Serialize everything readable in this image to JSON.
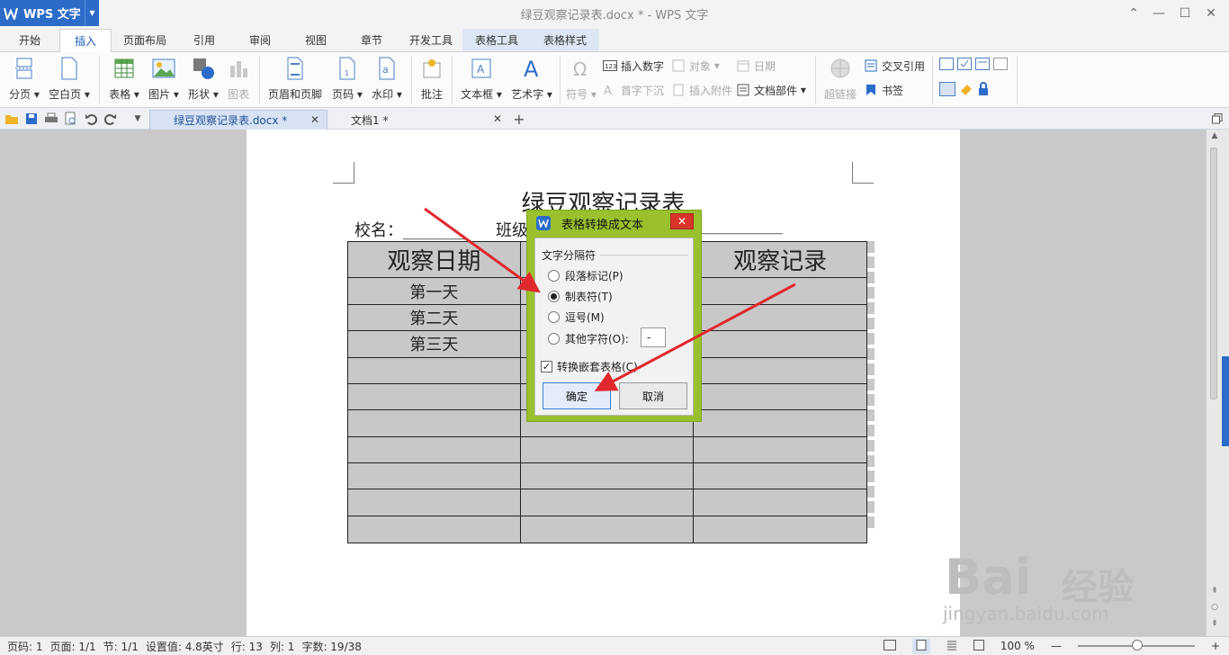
{
  "app": {
    "name": "WPS 文字",
    "document_title": "绿豆观察记录表.docx * - WPS 文字"
  },
  "menu": [
    "开始",
    "插入",
    "页面布局",
    "引用",
    "审阅",
    "视图",
    "章节",
    "开发工具",
    "表格工具",
    "表格样式"
  ],
  "ribbon": {
    "big": [
      "分页",
      "空白页",
      "表格",
      "图片",
      "形状",
      "图表",
      "页眉和页脚",
      "页码",
      "水印",
      "批注",
      "文本框",
      "艺术字",
      "符号",
      "超链接"
    ],
    "small": [
      "插入数字",
      "对象",
      "日期",
      "首字下沉",
      "插入附件",
      "文档部件",
      "交叉引用",
      "书签"
    ]
  },
  "tabs": [
    {
      "label": "绿豆观察记录表.docx *"
    },
    {
      "label": "文档1 *"
    }
  ],
  "document": {
    "heading": "绿豆观察记录表",
    "school_label": "校名：________",
    "class_label": "班级",
    "class_blank": "__________",
    "table": {
      "headers": [
        "观察日期",
        "",
        "观察记录"
      ],
      "rows": [
        [
          "第一天",
          "",
          ""
        ],
        [
          "第二天",
          "",
          ""
        ],
        [
          "第三天",
          "",
          ""
        ],
        [
          "",
          "",
          ""
        ],
        [
          "",
          "",
          ""
        ],
        [
          "",
          "",
          ""
        ],
        [
          "",
          "",
          ""
        ],
        [
          "",
          "",
          ""
        ],
        [
          "",
          "",
          ""
        ],
        [
          "",
          "",
          ""
        ]
      ]
    }
  },
  "dialog": {
    "title": "表格转换成文本",
    "close": "✕",
    "group": "文字分隔符",
    "options": [
      "段落标记(P)",
      "制表符(T)",
      "逗号(M)",
      "其他字符(O):"
    ],
    "selected_option": "制表符(T)",
    "other_value": "-",
    "checkbox": {
      "label": "转换嵌套表格(C)",
      "checked": true
    },
    "ok": "确定",
    "cancel": "取消"
  },
  "status": {
    "page_no": "页码: 1",
    "pages": "页面: 1/1",
    "section": "节: 1/1",
    "setting": "设置值: 4.8英寸",
    "row": "行: 13",
    "col": "列: 1",
    "words": "字数: 19/38",
    "zoom": "100 %"
  },
  "watermark": {
    "brand": "Bai",
    "brand2": "经验",
    "url": "jingyan.baidu.com"
  },
  "colors": {
    "accent": "#2b6cc9",
    "dialog_frame": "#9ac12d",
    "annotation_arrow": "#e0282e",
    "close": "#d9342b"
  }
}
